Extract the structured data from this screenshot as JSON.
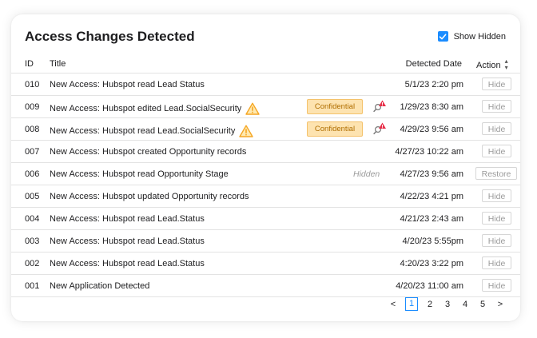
{
  "panel": {
    "title": "Access Changes Detected",
    "show_hidden_label": "Show Hidden",
    "show_hidden_checked": true
  },
  "columns": {
    "id": "ID",
    "title": "Title",
    "detected_date": "Detected Date",
    "action": "Action"
  },
  "rows": [
    {
      "id": "010",
      "title": "New Access: Hubspot read Lead Status",
      "date": "5/1/23 2:20 pm",
      "action": "Hide"
    },
    {
      "id": "009",
      "title": "New Access: Hubspot edited Lead.SocialSecurity",
      "warning": true,
      "badge": "Confidential",
      "alert": true,
      "date": "1/29/23 8:30 am",
      "action": "Hide"
    },
    {
      "id": "008",
      "title": "New Access: Hubspot read Lead.SocialSecurity",
      "warning": true,
      "badge": "Confidential",
      "alert": true,
      "date": "4/29/23 9:56 am",
      "action": "Hide"
    },
    {
      "id": "007",
      "title": "New Access: Hubspot created Opportunity records",
      "date": "4/27/23 10:22 am",
      "action": "Hide"
    },
    {
      "id": "006",
      "title": "New Access: Hubspot read Opportunity Stage",
      "status": "Hidden",
      "date": "4/27/23 9:56 am",
      "action": "Restore"
    },
    {
      "id": "005",
      "title": "New Access: Hubspot updated Opportunity records",
      "date": "4/22/23 4:21 pm",
      "action": "Hide"
    },
    {
      "id": "004",
      "title": "New Access: Hubspot read Lead.Status",
      "date": "4/21/23 2:43 am",
      "action": "Hide"
    },
    {
      "id": "003",
      "title": "New Access: Hubspot read Lead.Status",
      "date": "4/20/23 5:55pm",
      "action": "Hide"
    },
    {
      "id": "002",
      "title": "New Access: Hubspot read Lead.Status",
      "date": "4:20/23 3:22 pm",
      "action": "Hide"
    },
    {
      "id": "001",
      "title": "New Application Detected",
      "date": "4/20/23 11:00 am",
      "action": "Hide"
    }
  ],
  "pagination": {
    "prev": "<",
    "next": ">",
    "pages": [
      "1",
      "2",
      "3",
      "4",
      "5"
    ],
    "current": "1"
  },
  "colors": {
    "accent": "#1a8cff",
    "badge_bg": "#fde3b0",
    "badge_text": "#b06e00",
    "warning": "#f5a623",
    "alert": "#e8304a"
  }
}
